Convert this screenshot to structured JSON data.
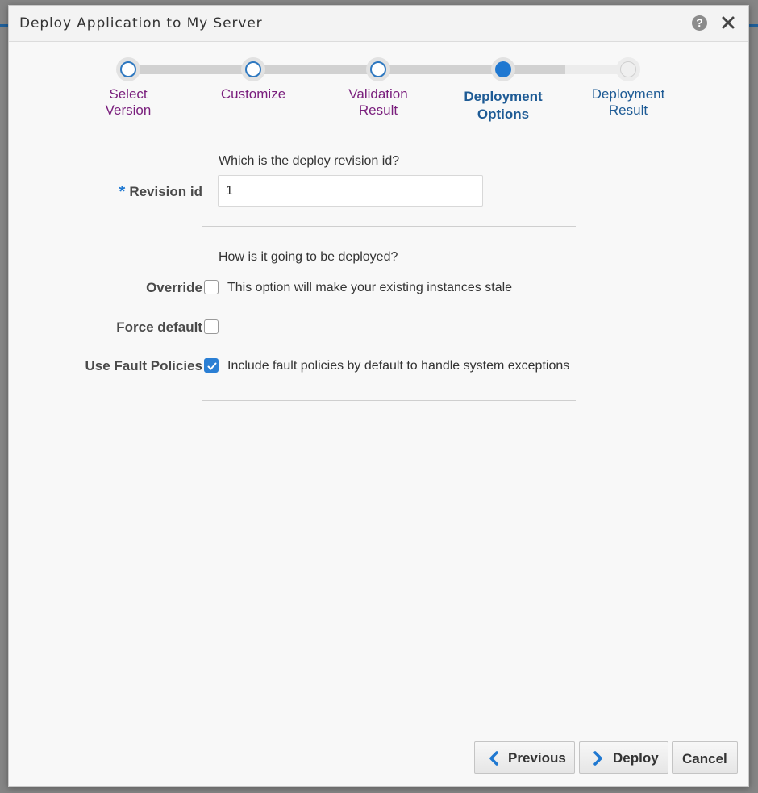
{
  "dialog": {
    "title": "Deploy Application to My Server",
    "help_glyph": "?",
    "close_glyph": "✕"
  },
  "train": {
    "stops": [
      {
        "line1": "Select",
        "line2": "Version",
        "state": "visited"
      },
      {
        "line1": "Customize",
        "line2": "",
        "state": "visited"
      },
      {
        "line1": "Validation",
        "line2": "Result",
        "state": "visited"
      },
      {
        "line1": "Deployment",
        "line2": "Options",
        "state": "current"
      },
      {
        "line1": "Deployment",
        "line2": "Result",
        "state": "future"
      }
    ]
  },
  "form": {
    "revision_hint": "Which is the deploy revision id?",
    "required_marker": "*",
    "revision_label": "Revision id",
    "revision_value": "1",
    "deploy_hint": "How is it going to be deployed?",
    "override_label": "Override",
    "override_checked": false,
    "override_text": "This option will make your existing instances stale",
    "force_label": "Force default",
    "force_checked": false,
    "fault_label": "Use Fault Policies",
    "fault_checked": true,
    "fault_text": "Include fault policies by default to handle system exceptions"
  },
  "footer": {
    "previous_label": "Previous",
    "deploy_label": "Deploy",
    "cancel_label": "Cancel"
  },
  "colors": {
    "accent": "#1f78d1",
    "visited_label": "#7a1f7d",
    "current_label": "#1e5b95"
  }
}
